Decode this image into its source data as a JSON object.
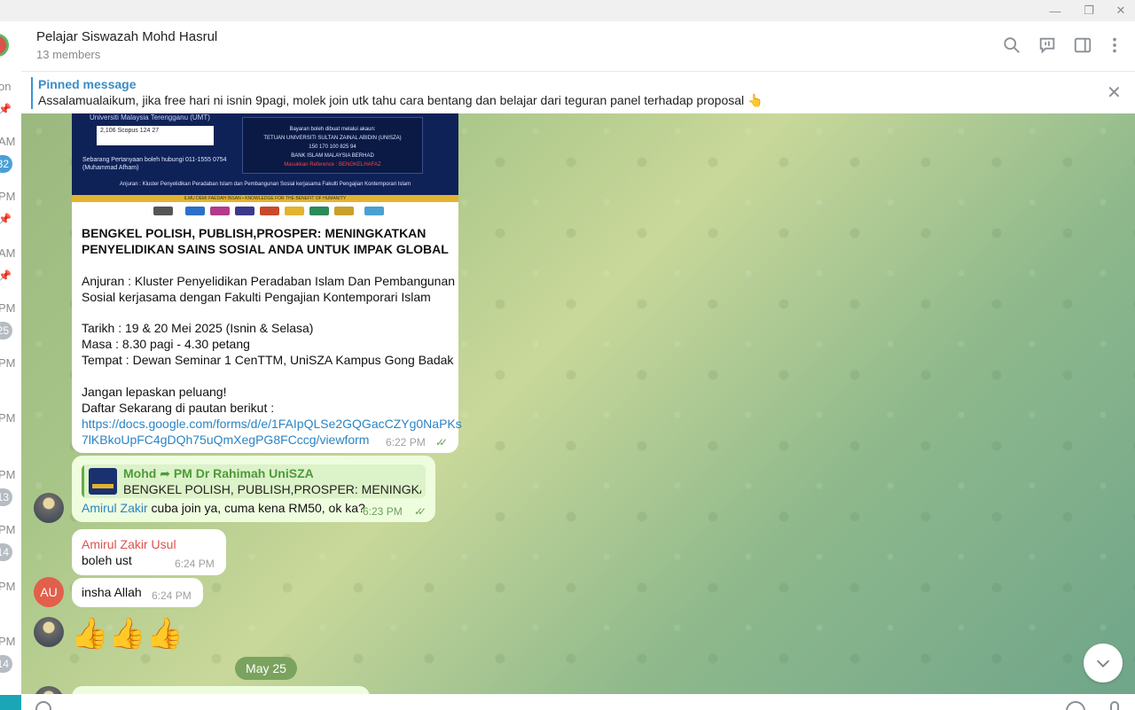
{
  "window": {
    "minimize": "—",
    "maximize": "❐",
    "close": "✕"
  },
  "chat_list": {
    "items": [
      {
        "time": "on"
      },
      {
        "time": "AM",
        "badge": "32"
      },
      {
        "time": "PM"
      },
      {
        "time": "AM"
      },
      {
        "time": "PM",
        "badge": "25"
      },
      {
        "time": "PM"
      },
      {
        "time": "PM"
      },
      {
        "time": "PM",
        "badge": "13"
      },
      {
        "time": "PM",
        "badge": "14"
      },
      {
        "time": "PM"
      },
      {
        "time": "PM",
        "badge": "14"
      }
    ]
  },
  "header": {
    "title": "Pelajar Siswazah Mohd Hasrul",
    "subtitle": "13 members"
  },
  "pinned": {
    "label": "Pinned message",
    "text": "Assalamualaikum, jika free hari ni isnin 9pagi, molek join utk tahu cara bentang dan belajar dari teguran panel terhadap proposal 👆"
  },
  "poster": {
    "university": "Universiti Malaysia Terengganu (UMT)",
    "stats": "2,106  Scopus  124   27",
    "payment_lines": [
      "Bayaran boleh dibuat melalui akaun:",
      "TETUAN UNIVERSITI SULTAN ZAINAL ABIDIN (UNISZA)",
      "150 170 100 825 94",
      "BANK ISLAM MALAYSIA BERHAD"
    ],
    "payment_ref": "Masukkan Reference : BENGKELHAFAZ",
    "contact": "Sebarang Pertanyaan boleh hubungi 011-1555 0754 (Muhammad Afham)",
    "anjuran": "Anjuran : Kluster Penyelidikan Peradaban Islam dan Pembangunan Sosial kerjasama Fakulti Pengajian Kontemporari Islam",
    "motto": "ILMU DEMI FAEDAH INSAN • KNOWLEDGE FOR THE BENEFIT OF HUMANITY"
  },
  "messages": {
    "main": {
      "title_lines": [
        "BENGKEL POLISH, PUBLISH,PROSPER: MENINGKATKAN",
        "PENYELIDIKAN SAINS SOSIAL ANDA UNTUK IMPAK GLOBAL"
      ],
      "anjuran_lines": [
        "Anjuran : Kluster Penyelidikan Peradaban Islam Dan Pembangunan",
        "Sosial kerjasama dengan Fakulti Pengajian Kontemporari Islam"
      ],
      "tarikh": "Tarikh : 19 & 20 Mei 2025 (Isnin & Selasa)",
      "masa": "Masa : 8.30 pagi - 4.30 petang",
      "tempat": "Tempat : Dewan Seminar 1 CenTTM,  UniSZA Kampus Gong Badak",
      "jangan": "Jangan lepaskan peluang!",
      "daftar": "Daftar Sekarang di pautan berikut :",
      "link_lines": [
        "https://docs.google.com/forms/d/e/1FAIpQLSe2GQGacCZYg0NaPKs",
        "7lKBkoUpFC4gDQh75uQmXegPG8FCccg/viewform"
      ],
      "time": "6:22 PM"
    },
    "reply_msg": {
      "reply_name": "Mohd ➦ PM Dr Rahimah UniSZA",
      "reply_text": "BENGKEL POLISH, PUBLISH,PROSPER: MENINGKATKA...",
      "mention": "Amirul Zakir",
      "text": " cuba join ya, cuma kena RM50, ok ka?",
      "time": "6:23 PM"
    },
    "amirul1": {
      "sender": "Amirul Zakir Usul",
      "text": "boleh ust",
      "time": "6:24 PM"
    },
    "amirul2": {
      "avatar": "AU",
      "text": "insha Allah",
      "time": "6:24 PM"
    },
    "thumbs": "👍👍👍"
  },
  "date_divider": "May 25",
  "colors": {
    "accent": "#3a8cc7",
    "sender_red": "#d9534f",
    "out_bubble": "#eefdde",
    "time_out": "#6ba35a"
  }
}
